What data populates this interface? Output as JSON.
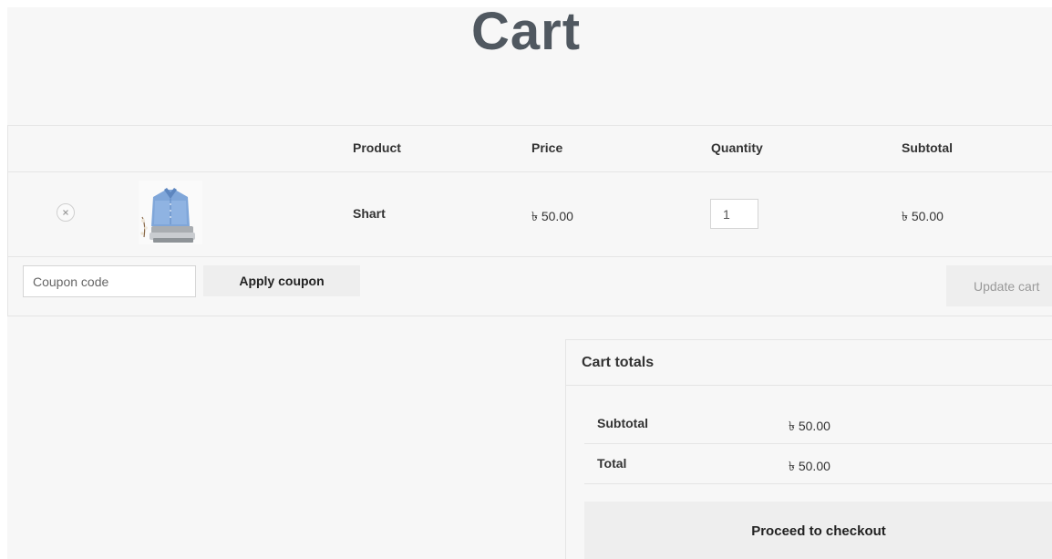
{
  "page": {
    "title": "Cart"
  },
  "cart": {
    "headers": {
      "product": "Product",
      "price": "Price",
      "quantity": "Quantity",
      "subtotal": "Subtotal"
    },
    "items": [
      {
        "name": "Shart",
        "price": "৳ 50.00",
        "quantity": "1",
        "subtotal": "৳ 50.00",
        "remove_icon": "remove-circle-x-icon",
        "thumbnail": "folded-blue-shirt"
      }
    ],
    "coupon": {
      "placeholder": "Coupon code",
      "value": "",
      "apply_label": "Apply coupon"
    },
    "update_label": "Update cart"
  },
  "totals": {
    "title": "Cart totals",
    "rows": [
      {
        "label": "Subtotal",
        "value": "৳ 50.00"
      },
      {
        "label": "Total",
        "value": "৳ 50.00"
      }
    ],
    "checkout_label": "Proceed to checkout"
  },
  "colors": {
    "background": "#f7f7f7",
    "title": "#505860",
    "button_bg": "#eeeeee",
    "border": "#e5e5e5"
  }
}
